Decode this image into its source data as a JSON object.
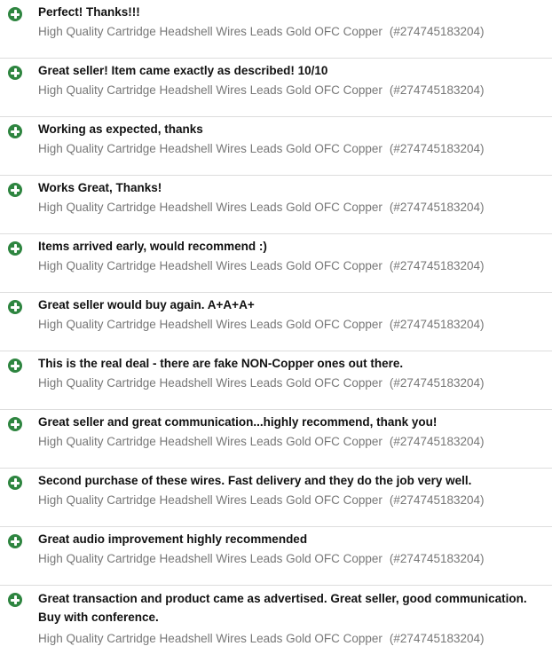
{
  "colors": {
    "positive_icon": "#2e8540",
    "comment_text": "#111111",
    "item_text": "#777777",
    "divider": "#dddddd"
  },
  "icon": "plus-circle-icon",
  "feedback": [
    {
      "comment": "Perfect! Thanks!!!",
      "item_title": "High Quality Cartridge Headshell Wires Leads Gold OFC Copper",
      "item_number": "(#274745183204)"
    },
    {
      "comment": "Great seller! Item came exactly as described! 10/10",
      "item_title": "High Quality Cartridge Headshell Wires Leads Gold OFC Copper",
      "item_number": "(#274745183204)"
    },
    {
      "comment": "Working as expected, thanks",
      "item_title": "High Quality Cartridge Headshell Wires Leads Gold OFC Copper",
      "item_number": "(#274745183204)"
    },
    {
      "comment": "Works Great, Thanks!",
      "item_title": "High Quality Cartridge Headshell Wires Leads Gold OFC Copper",
      "item_number": "(#274745183204)"
    },
    {
      "comment": "Items arrived early, would recommend :)",
      "item_title": "High Quality Cartridge Headshell Wires Leads Gold OFC Copper",
      "item_number": "(#274745183204)"
    },
    {
      "comment": "Great seller would buy again. A+A+A+",
      "item_title": "High Quality Cartridge Headshell Wires Leads Gold OFC Copper",
      "item_number": "(#274745183204)"
    },
    {
      "comment": "This is the real deal - there are fake NON-Copper ones out there.",
      "item_title": "High Quality Cartridge Headshell Wires Leads Gold OFC Copper",
      "item_number": "(#274745183204)"
    },
    {
      "comment": "Great seller and great communication...highly recommend, thank you!",
      "item_title": "High Quality Cartridge Headshell Wires Leads Gold OFC Copper",
      "item_number": "(#274745183204)"
    },
    {
      "comment": "Second purchase of these wires. Fast delivery and they do the job very well.",
      "item_title": "High Quality Cartridge Headshell Wires Leads Gold OFC Copper",
      "item_number": "(#274745183204)"
    },
    {
      "comment": "Great audio improvement highly recommended",
      "item_title": "High Quality Cartridge Headshell Wires Leads Gold OFC Copper",
      "item_number": "(#274745183204)"
    },
    {
      "comment": "Great transaction and product came as advertised. Great seller, good communication. Buy with conference.",
      "item_title": "High Quality Cartridge Headshell Wires Leads Gold OFC Copper",
      "item_number": "(#274745183204)"
    }
  ]
}
